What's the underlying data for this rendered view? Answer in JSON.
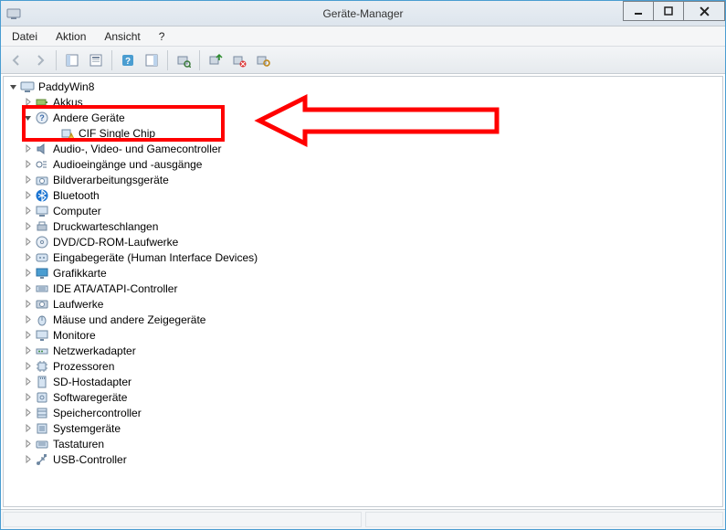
{
  "window": {
    "title": "Geräte-Manager"
  },
  "menu": {
    "file": "Datei",
    "action": "Aktion",
    "view": "Ansicht",
    "help": "?"
  },
  "tree": {
    "root": "PaddyWin8",
    "categories": [
      {
        "id": "akkus",
        "label": "Akkus",
        "icon": "battery",
        "expanded": false
      },
      {
        "id": "andere",
        "label": "Andere Geräte",
        "icon": "unknown",
        "expanded": true,
        "children": [
          {
            "id": "cif",
            "label": "CIF Single Chip",
            "icon": "warn-chip"
          }
        ]
      },
      {
        "id": "audio",
        "label": "Audio-, Video- und Gamecontroller",
        "icon": "speaker",
        "expanded": false
      },
      {
        "id": "audioio",
        "label": "Audioeingänge und -ausgänge",
        "icon": "audioio",
        "expanded": false
      },
      {
        "id": "bildverarb",
        "label": "Bildverarbeitungsgeräte",
        "icon": "camera",
        "expanded": false
      },
      {
        "id": "bluetooth",
        "label": "Bluetooth",
        "icon": "bluetooth",
        "expanded": false
      },
      {
        "id": "computer",
        "label": "Computer",
        "icon": "computer",
        "expanded": false
      },
      {
        "id": "druckwarte",
        "label": "Druckwarteschlangen",
        "icon": "printer",
        "expanded": false
      },
      {
        "id": "dvd",
        "label": "DVD/CD-ROM-Laufwerke",
        "icon": "disc",
        "expanded": false
      },
      {
        "id": "hid",
        "label": "Eingabegeräte (Human Interface Devices)",
        "icon": "hid",
        "expanded": false
      },
      {
        "id": "grafik",
        "label": "Grafikkarte",
        "icon": "display",
        "expanded": false
      },
      {
        "id": "ide",
        "label": "IDE ATA/ATAPI-Controller",
        "icon": "ide",
        "expanded": false
      },
      {
        "id": "laufwerke",
        "label": "Laufwerke",
        "icon": "drive",
        "expanded": false
      },
      {
        "id": "maus",
        "label": "Mäuse und andere Zeigegeräte",
        "icon": "mouse",
        "expanded": false
      },
      {
        "id": "monitore",
        "label": "Monitore",
        "icon": "monitor",
        "expanded": false
      },
      {
        "id": "netzwerk",
        "label": "Netzwerkadapter",
        "icon": "network",
        "expanded": false
      },
      {
        "id": "prozessoren",
        "label": "Prozessoren",
        "icon": "cpu",
        "expanded": false
      },
      {
        "id": "sdhost",
        "label": "SD-Hostadapter",
        "icon": "sd",
        "expanded": false
      },
      {
        "id": "software",
        "label": "Softwaregeräte",
        "icon": "software",
        "expanded": false
      },
      {
        "id": "speicher",
        "label": "Speichercontroller",
        "icon": "storage",
        "expanded": false
      },
      {
        "id": "system",
        "label": "Systemgeräte",
        "icon": "system",
        "expanded": false
      },
      {
        "id": "tastaturen",
        "label": "Tastaturen",
        "icon": "keyboard",
        "expanded": false
      },
      {
        "id": "usb",
        "label": "USB-Controller",
        "icon": "usb",
        "expanded": false
      }
    ]
  },
  "colors": {
    "annotation": "#ff0000",
    "window_border": "#4a9dd1"
  }
}
